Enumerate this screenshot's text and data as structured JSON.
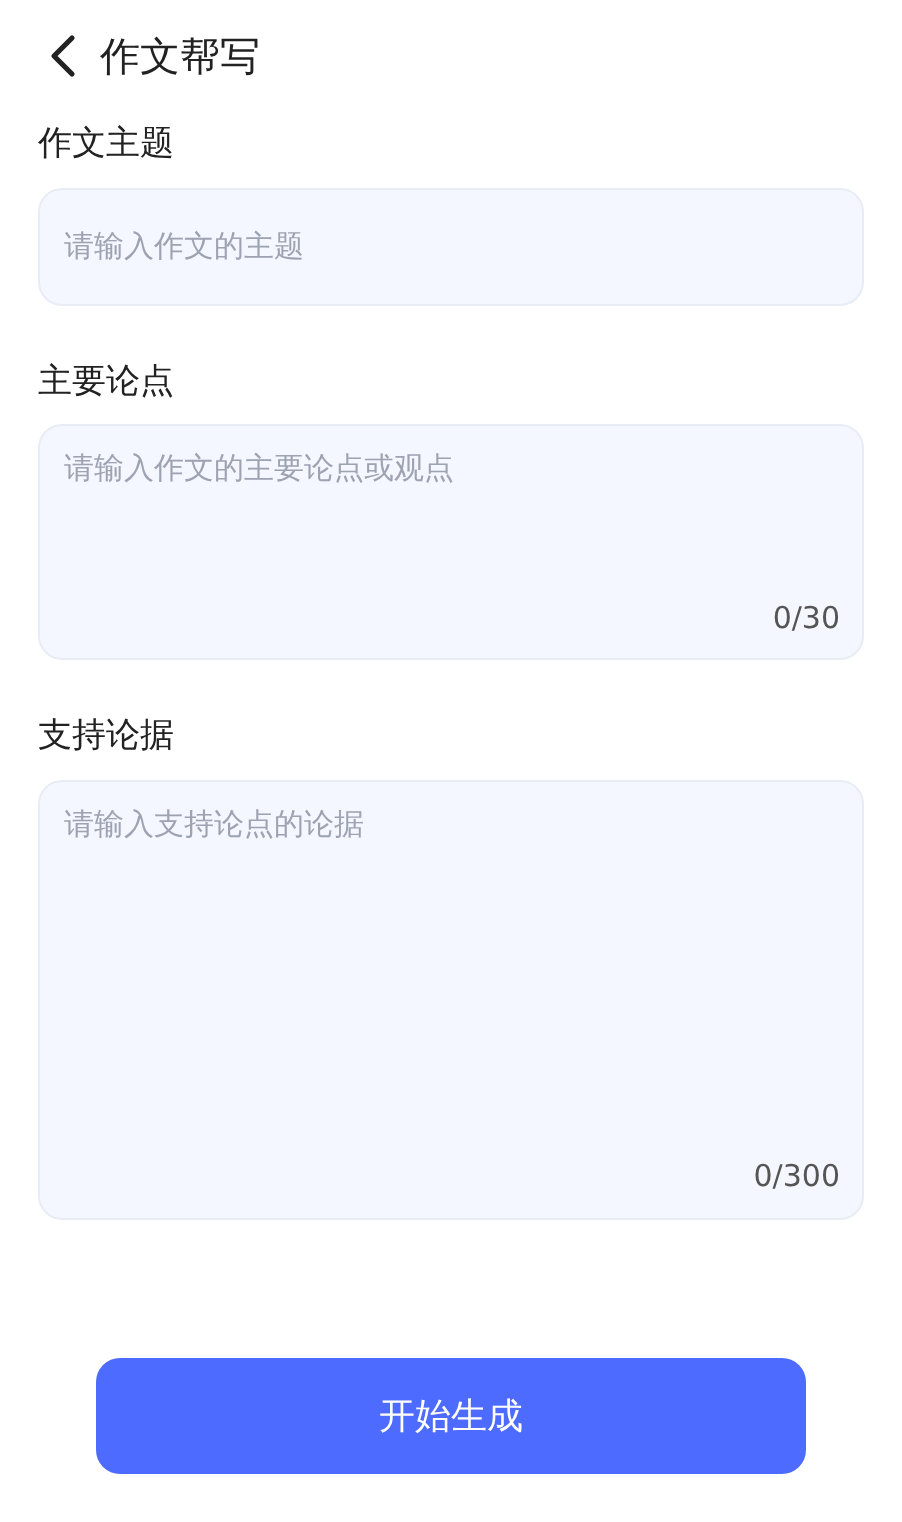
{
  "header": {
    "title": "作文帮写"
  },
  "fields": [
    {
      "kind": "line",
      "label": "作文主题",
      "placeholder": "请输入作文的主题"
    },
    {
      "kind": "box",
      "label": "主要论点",
      "placeholder": "请输入作文的主要论点或观点",
      "counter": "0/30"
    },
    {
      "kind": "tallbox",
      "label": "支持论据",
      "placeholder": "请输入支持论点的论据",
      "counter": "0/300"
    }
  ],
  "button": {
    "label": "开始生成"
  }
}
